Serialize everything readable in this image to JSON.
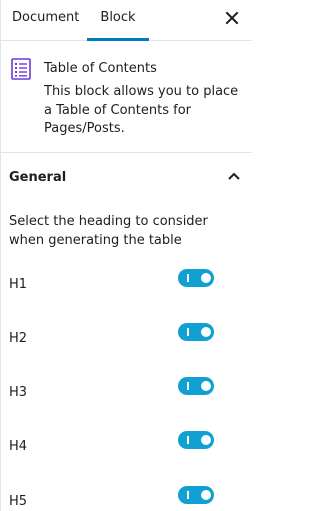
{
  "tabs": {
    "document": "Document",
    "block": "Block"
  },
  "block": {
    "icon": "table-of-contents-icon",
    "title": "Table of Contents",
    "description": "This block allows you to place a Table of Contents for Pages/Posts."
  },
  "panel": {
    "title": "General",
    "expanded": true,
    "help_text": "Select the heading to consider when generating the table",
    "headings": [
      {
        "label": "H1",
        "enabled": true
      },
      {
        "label": "H2",
        "enabled": true
      },
      {
        "label": "H3",
        "enabled": true
      },
      {
        "label": "H4",
        "enabled": true
      },
      {
        "label": "H5",
        "enabled": true
      }
    ]
  },
  "colors": {
    "accent": "#007cba",
    "toggle_on": "#11a0d2",
    "icon": "#6e39e0"
  }
}
